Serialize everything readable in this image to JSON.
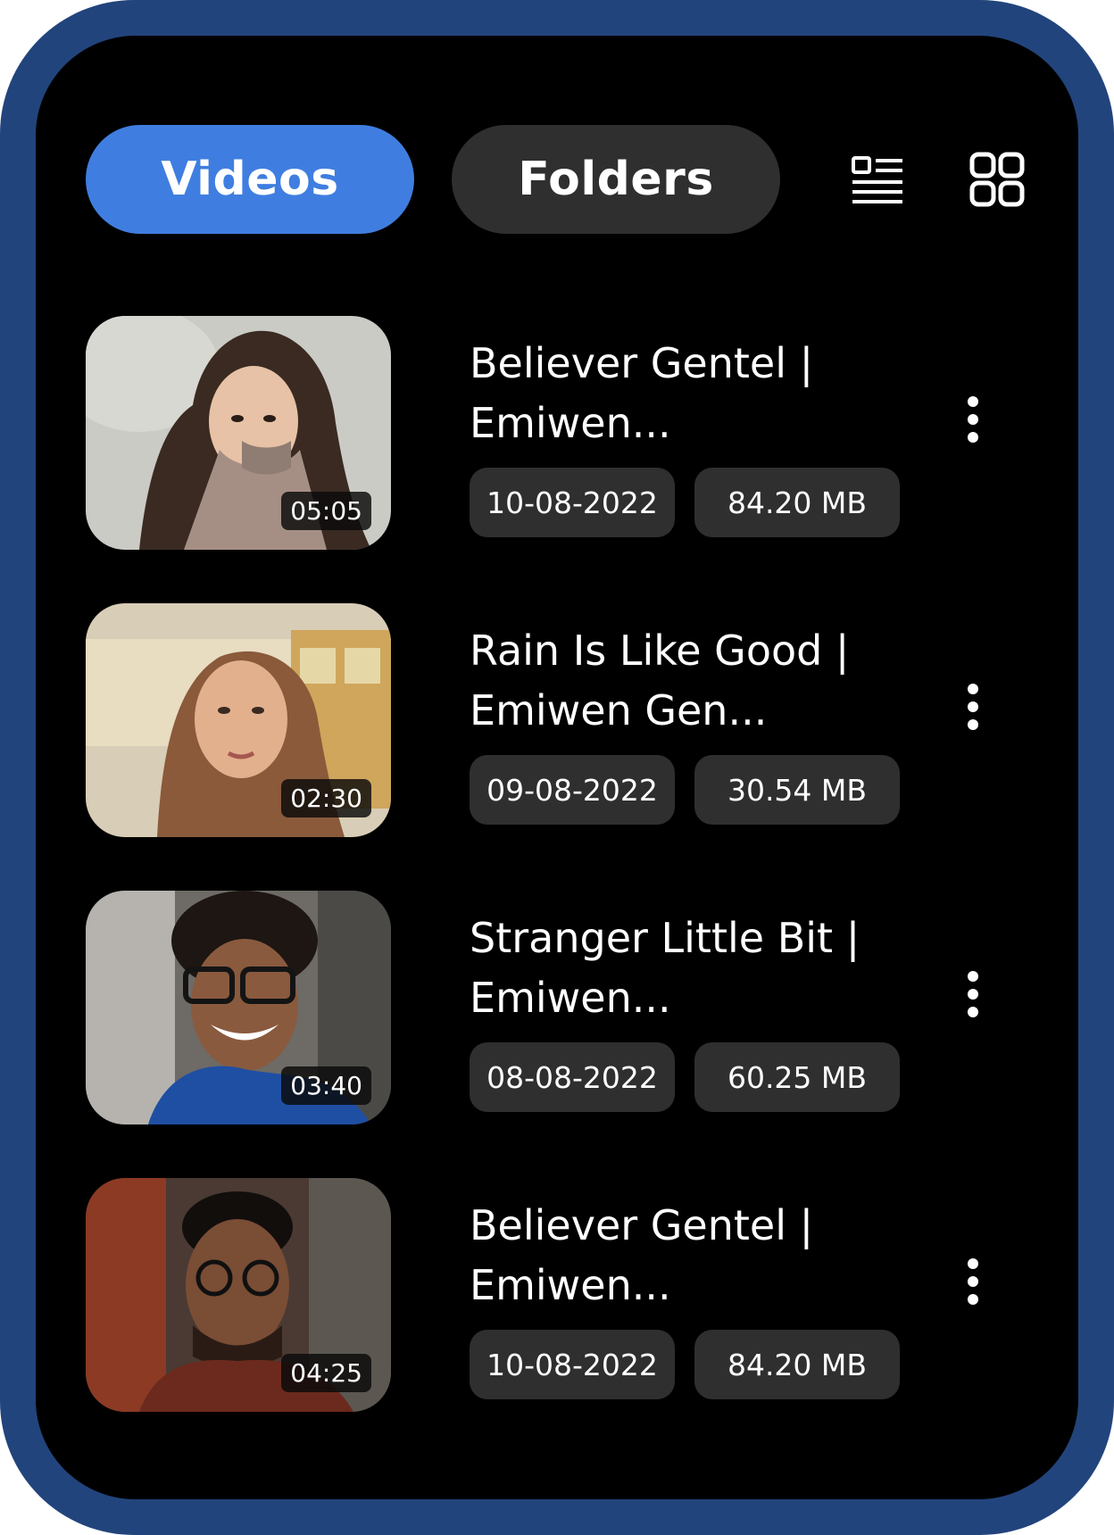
{
  "tabs": {
    "videos": "Videos",
    "folders": "Folders"
  },
  "view_icons": [
    "list-view-icon",
    "grid-view-icon"
  ],
  "colors": {
    "frame": "#22447c",
    "active_tab": "#3f7ee0",
    "inactive_tab": "#2f2f2f",
    "chip": "#2f2f2f"
  },
  "videos": [
    {
      "title": "Believer Gentel |\nEmiwen...",
      "date": "10-08-2022",
      "size": "84.20 MB",
      "duration": "05:05"
    },
    {
      "title": "Rain Is Like Good |\nEmiwen Gen...",
      "date": "09-08-2022",
      "size": "30.54 MB",
      "duration": "02:30"
    },
    {
      "title": "Stranger Little Bit |\nEmiwen...",
      "date": "08-08-2022",
      "size": "60.25 MB",
      "duration": "03:40"
    },
    {
      "title": "Believer Gentel |\nEmiwen...",
      "date": "10-08-2022",
      "size": "84.20 MB",
      "duration": "04:25"
    }
  ]
}
